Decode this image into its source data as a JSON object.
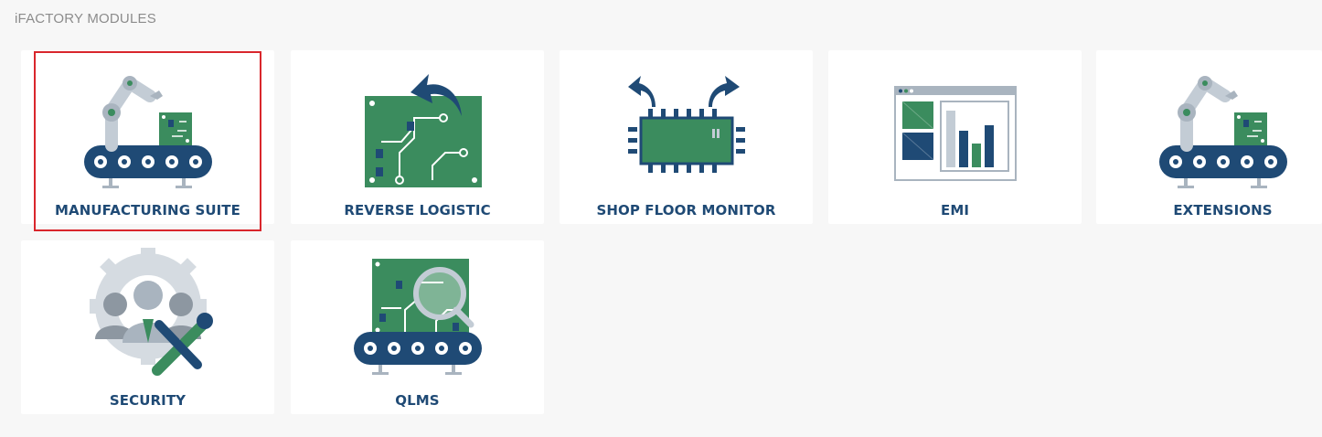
{
  "page_title": "iFACTORY MODULES",
  "colors": {
    "navy": "#1f4a75",
    "green": "#3b8c5e",
    "grey": "#a9b4bf",
    "selected_border": "#d9262c"
  },
  "modules": [
    {
      "label": "MANUFACTURING SUITE",
      "icon": "robot-arm-conveyor-icon",
      "selected": true
    },
    {
      "label": "REVERSE LOGISTIC",
      "icon": "circuit-board-return-icon",
      "selected": false
    },
    {
      "label": "SHOP FLOOR MONITOR",
      "icon": "chip-monitor-icon",
      "selected": false
    },
    {
      "label": "EMI",
      "icon": "dashboard-chart-icon",
      "selected": false
    },
    {
      "label": "EXTENSIONS",
      "icon": "robot-arm-conveyor-icon",
      "selected": false
    },
    {
      "label": "SECURITY",
      "icon": "users-gear-wrench-icon",
      "selected": false
    },
    {
      "label": "QLMS",
      "icon": "board-magnifier-conveyor-icon",
      "selected": false
    }
  ]
}
